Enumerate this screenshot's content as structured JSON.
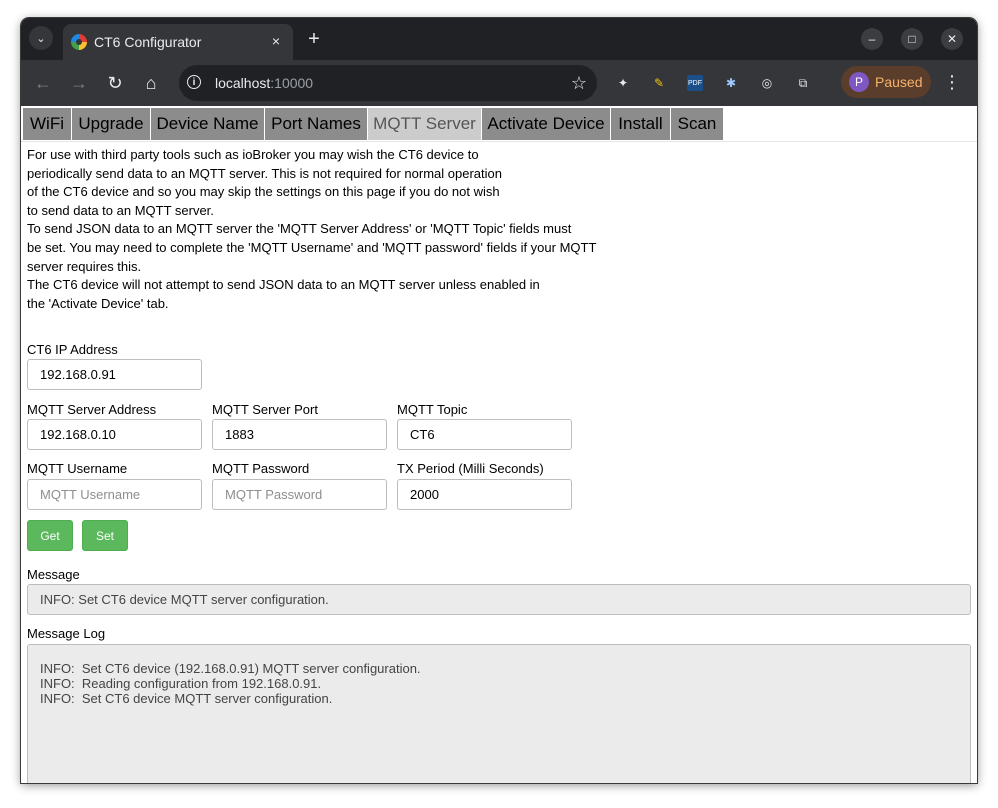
{
  "browser": {
    "tab_title": "CT6 Configurator",
    "tab_close": "×",
    "new_tab": "+",
    "url_host": "localhost",
    "url_port": ":10000",
    "profile_initial": "P",
    "profile_status": "Paused",
    "window_controls": {
      "minimize": "–",
      "maximize": "□",
      "close": "✕"
    }
  },
  "nav": {
    "tabs": [
      {
        "label": "WiFi"
      },
      {
        "label": "Upgrade"
      },
      {
        "label": "Device Name"
      },
      {
        "label": "Port Names"
      },
      {
        "label": "MQTT Server",
        "active": true
      },
      {
        "label": "Activate Device"
      },
      {
        "label": "Install"
      },
      {
        "label": "Scan"
      }
    ]
  },
  "description": {
    "lines": [
      "For use with third party tools such as ioBroker you may wish the CT6 device to",
      "periodically send data to an MQTT server. This is not required for normal operation",
      "of the CT6 device and so you may skip the settings on this page if you do not wish",
      "to send data to an MQTT server.",
      "To send JSON data to an MQTT server the 'MQTT Server Address' or 'MQTT Topic' fields must",
      "be set. You may need to complete the 'MQTT Username' and 'MQTT password' fields if your MQTT",
      "server requires this.",
      "The CT6 device will not attempt to send JSON data to an MQTT server unless enabled in",
      "the 'Activate Device' tab."
    ]
  },
  "form": {
    "ct6_ip": {
      "label": "CT6 IP Address",
      "value": "192.168.0.91"
    },
    "server_address": {
      "label": "MQTT Server Address",
      "value": "192.168.0.10"
    },
    "server_port": {
      "label": "MQTT Server Port",
      "value": "1883"
    },
    "topic": {
      "label": "MQTT Topic",
      "value": "CT6"
    },
    "username": {
      "label": "MQTT Username",
      "value": "",
      "placeholder": "MQTT Username"
    },
    "password": {
      "label": "MQTT Password",
      "value": "",
      "placeholder": "MQTT Password"
    },
    "tx_period": {
      "label": "TX Period (Milli Seconds)",
      "value": "2000"
    },
    "get_label": "Get",
    "set_label": "Set"
  },
  "message": {
    "label": "Message",
    "text": "INFO:  Set CT6 device MQTT server configuration."
  },
  "log": {
    "label": "Message Log",
    "lines": [
      "INFO:  Set CT6 device (192.168.0.91) MQTT server configuration.",
      "INFO:  Reading configuration from 192.168.0.91.",
      "INFO:  Set CT6 device MQTT server configuration."
    ]
  },
  "colors": {
    "button_green": "#5cb85c",
    "tab_inactive": "#8c8c8c",
    "tab_active": "#cccccc"
  }
}
